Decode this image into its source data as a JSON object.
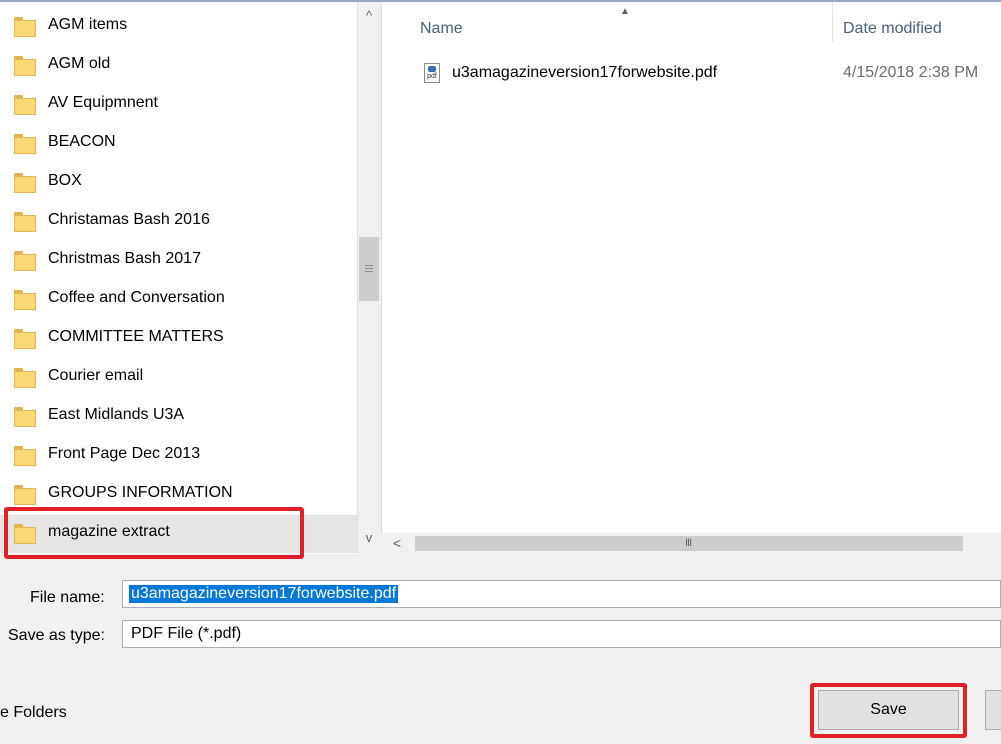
{
  "nav": {
    "folders": [
      {
        "label": "AGM items"
      },
      {
        "label": "AGM old"
      },
      {
        "label": "AV Equipmnent"
      },
      {
        "label": "BEACON"
      },
      {
        "label": "BOX"
      },
      {
        "label": "Christamas Bash 2016"
      },
      {
        "label": "Christmas Bash 2017"
      },
      {
        "label": "Coffee and Conversation"
      },
      {
        "label": "COMMITTEE MATTERS"
      },
      {
        "label": "Courier email"
      },
      {
        "label": "East Midlands U3A"
      },
      {
        "label": "Front Page Dec 2013"
      },
      {
        "label": "GROUPS INFORMATION"
      },
      {
        "label": "magazine extract"
      }
    ],
    "selected_folder": "magazine extract",
    "scroll_up_glyph": "^",
    "scroll_down_glyph": "v"
  },
  "file_list": {
    "columns": {
      "name": "Name",
      "date_modified": "Date modified"
    },
    "files": [
      {
        "name": "u3amagazineversion17forwebsite.pdf",
        "date_modified": "4/15/2018 2:38 PM",
        "icon": "pdf-file-icon"
      }
    ],
    "scroll_left_glyph": "<",
    "h_grip_glyph": "III"
  },
  "form": {
    "file_name_label": "File name:",
    "file_name_value": "u3amagazineversion17forwebsite.pdf",
    "save_as_type_label": "Save as type:",
    "save_as_type_value": "PDF File (*.pdf)"
  },
  "footer": {
    "hide_folders_label": "e Folders",
    "save_button_label": "Save"
  },
  "colors": {
    "highlight": "#e0202a",
    "selection": "#0078d7",
    "header_text": "#4c607a"
  }
}
